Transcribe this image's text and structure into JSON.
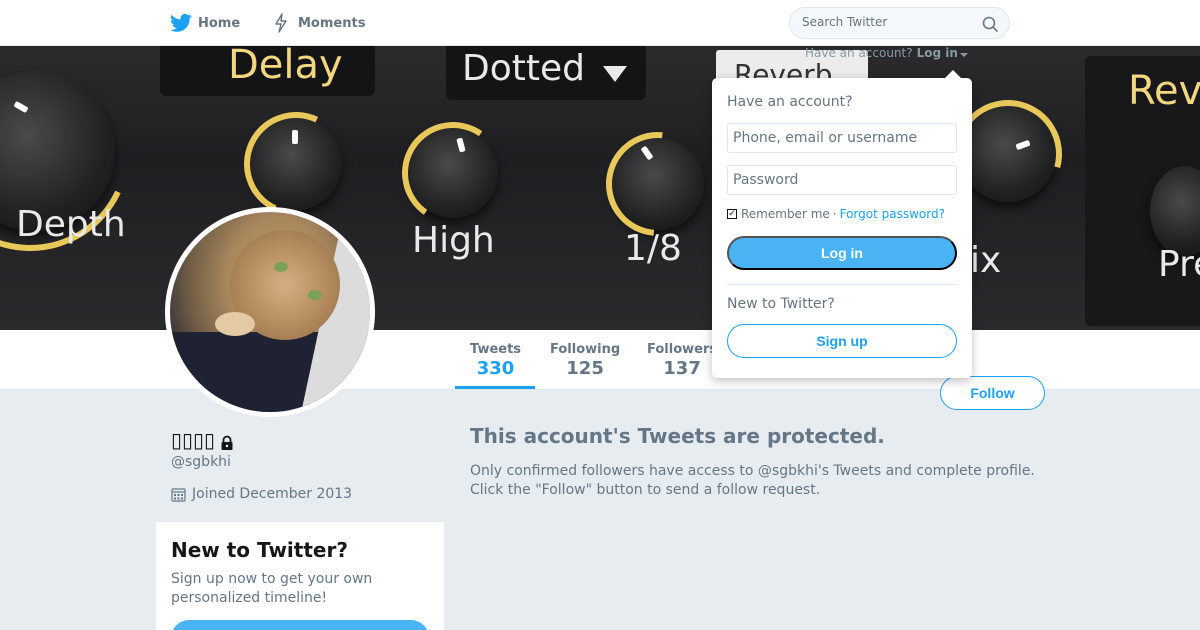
{
  "nav": {
    "home_label": "Home",
    "moments_label": "Moments",
    "home_icon": "twitter-bird-icon",
    "moments_icon": "lightning-icon",
    "search_placeholder": "Search Twitter"
  },
  "banner": {
    "labels": [
      "Delay",
      "Dotted",
      "Reverb",
      "Rev",
      "Depth",
      "High",
      "1/8",
      "ix",
      "Pre"
    ]
  },
  "login": {
    "prompt": "Have an account?",
    "link": "Log in",
    "heading": "Have an account?",
    "username_placeholder": "Phone, email or username",
    "password_placeholder": "Password",
    "remember_checked": true,
    "remember_label": "Remember me",
    "separator": "·",
    "forgot_label": "Forgot password?",
    "login_button": "Log in",
    "new_heading": "New to Twitter?",
    "signup_button": "Sign up"
  },
  "profile": {
    "name": "▯▯▯▯",
    "handle": "@sgbkhi",
    "joined": "Joined December 2013",
    "stats": [
      {
        "label": "Tweets",
        "value": "330",
        "active": true
      },
      {
        "label": "Following",
        "value": "125",
        "active": false
      },
      {
        "label": "Followers",
        "value": "137",
        "active": false
      }
    ],
    "follow_button": "Follow"
  },
  "signup_card": {
    "title": "New to Twitter?",
    "text": "Sign up now to get your own personalized timeline!"
  },
  "main": {
    "protected_title": "This account's Tweets are protected.",
    "protected_text": "Only confirmed followers have access to @sgbkhi's Tweets and complete profile. Click the \"Follow\" button to send a follow request."
  },
  "colors": {
    "accent": "#1da1f2",
    "button_fill": "#4ab3f4",
    "page_bg": "#e6ecf0",
    "muted_text": "#657786"
  }
}
